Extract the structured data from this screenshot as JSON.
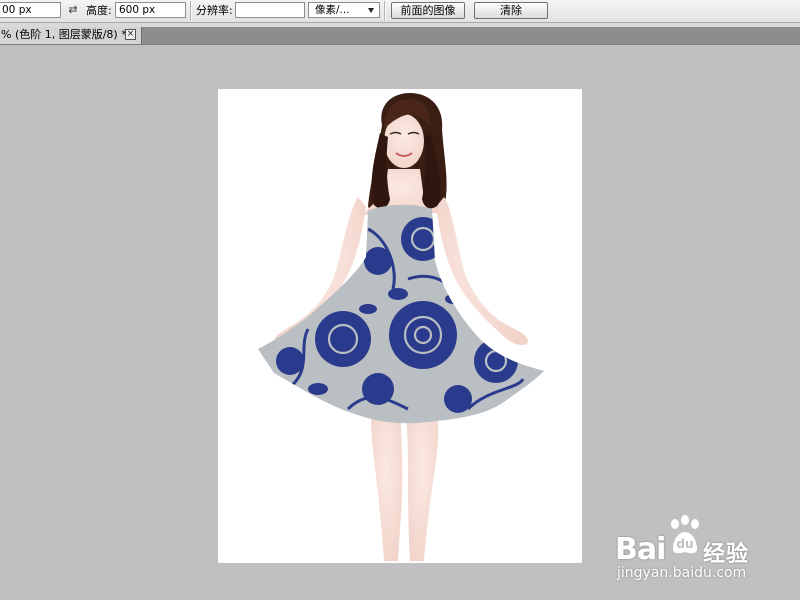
{
  "options_bar": {
    "width_value": "00 px",
    "height_label": "高度:",
    "height_value": "600 px",
    "resolution_label": "分辨率:",
    "resolution_value": "",
    "resolution_unit": "像素/...",
    "front_image_button": "前面的图像",
    "clear_button": "清除"
  },
  "document_tab": {
    "title": "% (色阶 1, 图层蒙版/8) *",
    "close_glyph": "×"
  },
  "watermark": {
    "brand_left": "Bai",
    "brand_right": "du",
    "service": "经验",
    "url": "jingyan.baidu.com"
  },
  "icons": {
    "swap": "swap-icon",
    "dropdown": "chevron-down-icon",
    "close": "close-icon",
    "paw": "baidu-paw-icon"
  },
  "colors": {
    "workspace": "#c0c0c0",
    "document": "#ffffff",
    "dress_blue": "#2a3a8c",
    "dress_base": "#b9bfc2"
  }
}
